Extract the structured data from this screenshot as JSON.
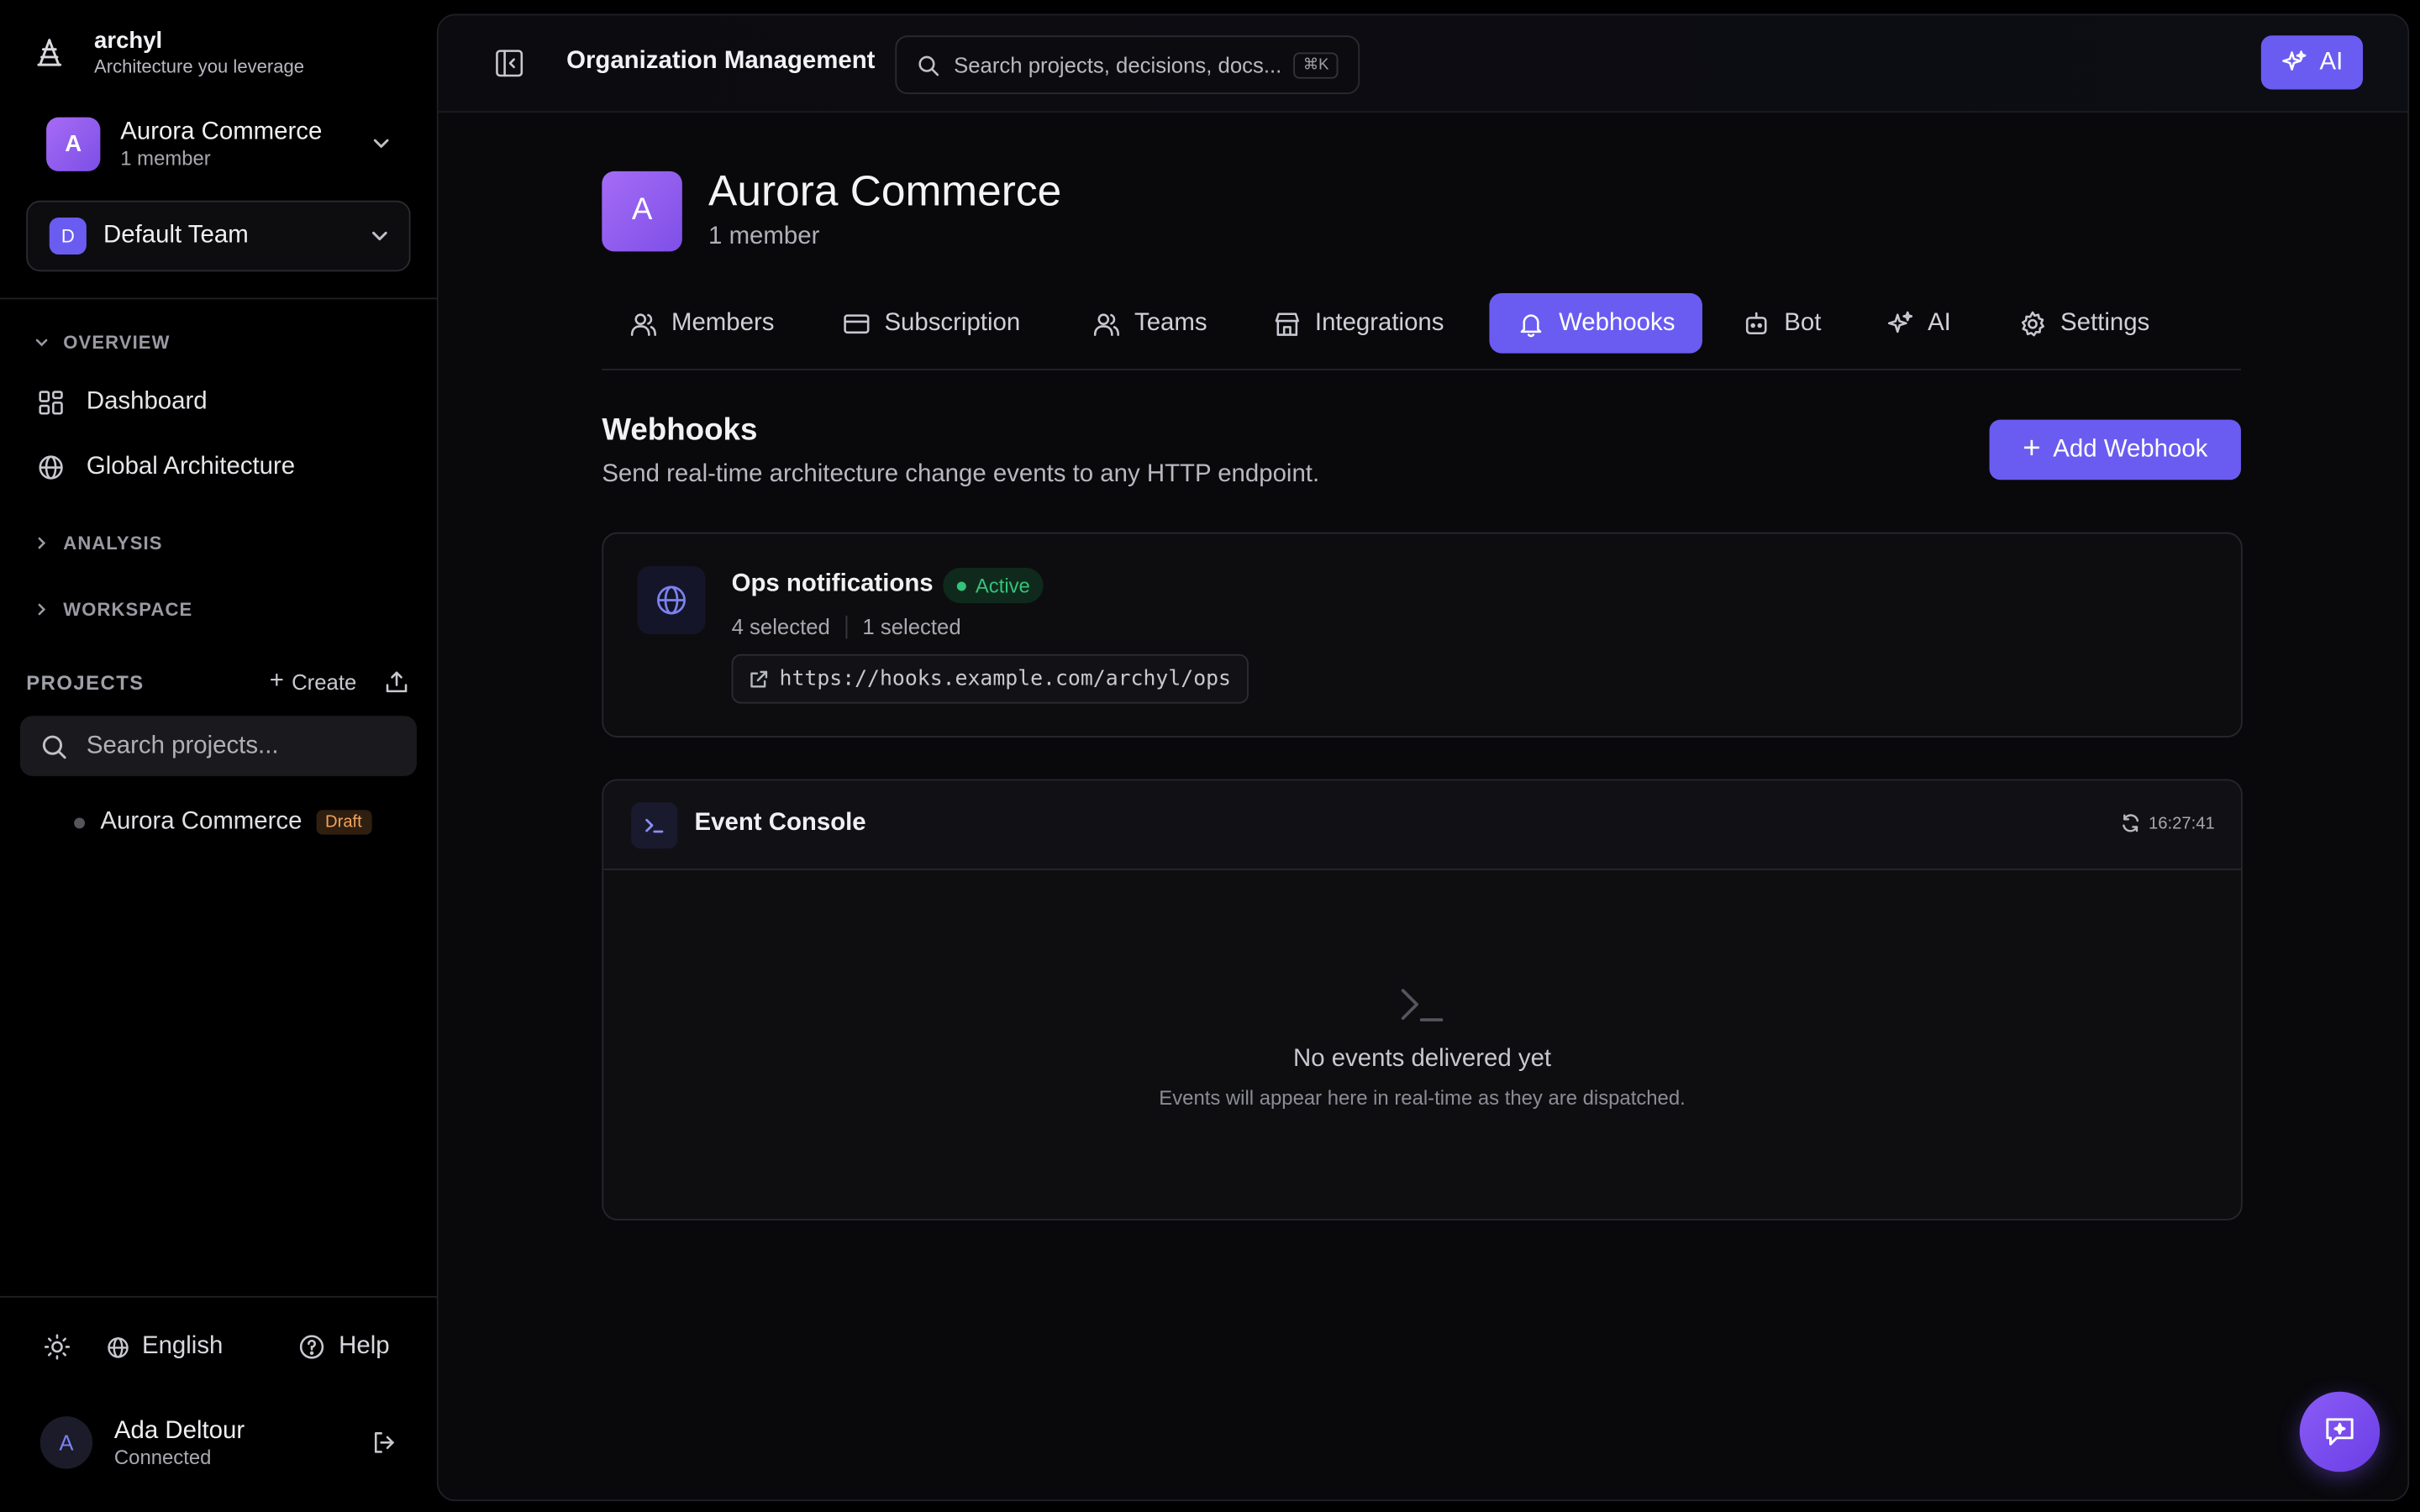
{
  "brand": {
    "name": "archyl",
    "tagline": "Architecture you leverage"
  },
  "org_switcher": {
    "avatar": "A",
    "name": "Aurora Commerce",
    "members": "1 member"
  },
  "team_selector": {
    "avatar": "D",
    "name": "Default Team"
  },
  "nav": {
    "overview_label": "OVERVIEW",
    "items": [
      {
        "label": "Dashboard",
        "icon": "grid-icon"
      },
      {
        "label": "Global Architecture",
        "icon": "globe-icon"
      }
    ],
    "analysis_label": "ANALYSIS",
    "workspace_label": "WORKSPACE"
  },
  "projects": {
    "label": "PROJECTS",
    "create_label": "Create",
    "search_placeholder": "Search projects...",
    "items": [
      {
        "name": "Aurora Commerce",
        "badge": "Draft"
      }
    ]
  },
  "footer": {
    "language": "English",
    "help": "Help",
    "user": {
      "avatar": "A",
      "name": "Ada Deltour",
      "status": "Connected"
    }
  },
  "topbar": {
    "title": "Organization Management",
    "search_placeholder": "Search projects, decisions, docs...",
    "search_shortcut": "⌘K",
    "ai_label": "AI"
  },
  "org_header": {
    "avatar": "A",
    "name": "Aurora Commerce",
    "members": "1 member"
  },
  "tabs": [
    {
      "label": "Members",
      "icon": "users-icon"
    },
    {
      "label": "Subscription",
      "icon": "credit-card-icon"
    },
    {
      "label": "Teams",
      "icon": "team-icon"
    },
    {
      "label": "Integrations",
      "icon": "store-icon"
    },
    {
      "label": "Webhooks",
      "icon": "bell-icon",
      "active": true
    },
    {
      "label": "Bot",
      "icon": "bot-icon"
    },
    {
      "label": "AI",
      "icon": "sparkles-icon"
    },
    {
      "label": "Settings",
      "icon": "gear-icon"
    }
  ],
  "webhooks": {
    "title": "Webhooks",
    "description": "Send real-time architecture change events to any HTTP endpoint.",
    "add_label": "Add Webhook",
    "items": [
      {
        "name": "Ops notifications",
        "status": "Active",
        "events_selected": "4 selected",
        "projects_selected": "1 selected",
        "url": "https://hooks.example.com/archyl/ops"
      }
    ]
  },
  "console": {
    "title": "Event Console",
    "last_refresh": "16:27:41",
    "empty_title": "No events delivered yet",
    "empty_subtitle": "Events will appear here in real-time as they are dispatched."
  },
  "colors": {
    "accent": "#6a5cf0",
    "active_status": "#35c27a",
    "draft_badge": "#f2a35b"
  }
}
